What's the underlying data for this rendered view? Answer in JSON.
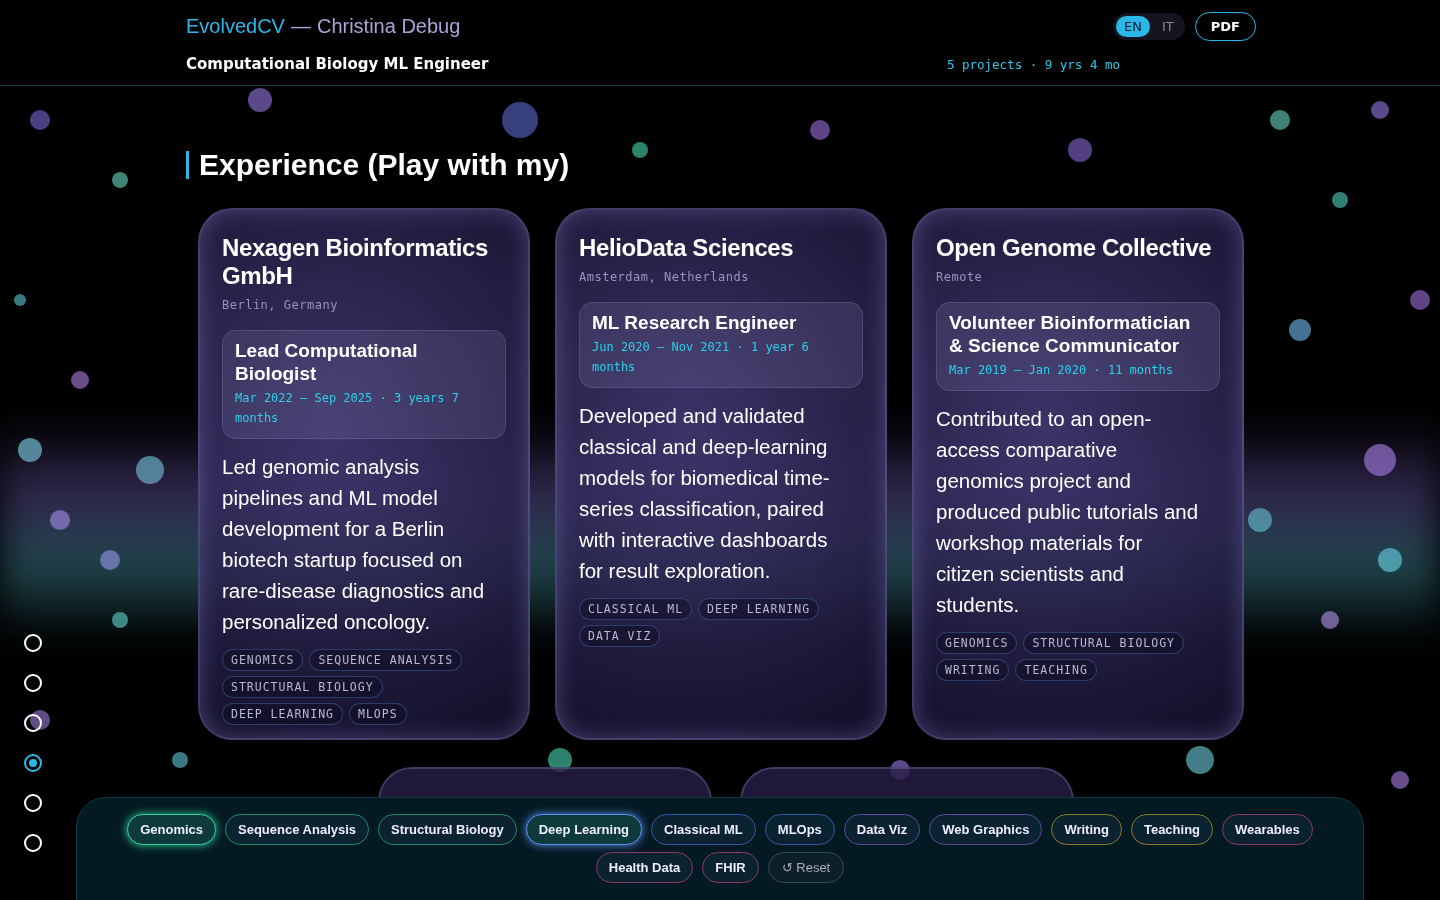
{
  "header": {
    "brand": "EvolvedCV",
    "separator": "—",
    "name": "Christina Debug",
    "role": "Computational Biology ML Engineer",
    "stats": "5 projects · 9 yrs 4 mo",
    "languages": [
      {
        "label": "EN",
        "selected": true
      },
      {
        "label": "IT",
        "selected": false
      }
    ],
    "pdf_button": "PDF"
  },
  "section": {
    "title": "Experience (Play with my)"
  },
  "experience": [
    {
      "company": "Nexagen Bioinformatics GmbH",
      "location": "Berlin, Germany",
      "role": "Lead Computational Biologist",
      "period": "Mar 2022 – Sep 2025 · 3 years 7 months",
      "description": "Led genomic analysis pipelines and ML model development for a Berlin biotech startup focused on rare-disease diagnostics and personalized oncology.",
      "tags": [
        "GENOMICS",
        "SEQUENCE ANALYSIS",
        "STRUCTURAL BIOLOGY",
        "DEEP LEARNING",
        "MLOPS"
      ]
    },
    {
      "company": "HelioData Sciences",
      "location": "Amsterdam, Netherlands",
      "role": "ML Research Engineer",
      "period": "Jun 2020 – Nov 2021 · 1 year 6 months",
      "description": "Developed and validated classical and deep-learning models for biomedical time-series classification, paired with interactive dashboards for result exploration.",
      "tags": [
        "CLASSICAL ML",
        "DEEP LEARNING",
        "DATA VIZ"
      ]
    },
    {
      "company": "Open Genome Collective",
      "location": "Remote",
      "role": "Volunteer Bioinformatician & Science Communicator",
      "period": "Mar 2019 – Jan 2020 · 11 months",
      "description": "Contributed to an open-access comparative genomics project and produced public tutorials and workshop materials for citizen scientists and students.",
      "tags": [
        "GENOMICS",
        "STRUCTURAL BIOLOGY",
        "WRITING",
        "TEACHING"
      ]
    }
  ],
  "section_nav": [
    {
      "selected": false
    },
    {
      "selected": false
    },
    {
      "selected": false
    },
    {
      "selected": true
    },
    {
      "selected": false
    },
    {
      "selected": false
    }
  ],
  "filters": [
    {
      "label": "Genomics",
      "color": "#2fcf9a",
      "selected": true
    },
    {
      "label": "Sequence Analysis",
      "color": "#1f8a68",
      "selected": false
    },
    {
      "label": "Structural Biology",
      "color": "#1f8a68",
      "selected": false
    },
    {
      "label": "Deep Learning",
      "color": "#5b8cf0",
      "selected": true
    },
    {
      "label": "Classical ML",
      "color": "#2f5a9e",
      "selected": false
    },
    {
      "label": "MLOps",
      "color": "#2f5a9e",
      "selected": false
    },
    {
      "label": "Data Viz",
      "color": "#5a4a9a",
      "selected": false
    },
    {
      "label": "Web Graphics",
      "color": "#5a4a9a",
      "selected": false
    },
    {
      "label": "Writing",
      "color": "#8a7a2a",
      "selected": false
    },
    {
      "label": "Teaching",
      "color": "#8a7a2a",
      "selected": false
    },
    {
      "label": "Wearables",
      "color": "#8a3a6a",
      "selected": false
    },
    {
      "label": "Health Data",
      "color": "#8a3a6a",
      "selected": false
    },
    {
      "label": "FHIR",
      "color": "#8a3a6a",
      "selected": false
    }
  ],
  "reset_button": {
    "icon": "↺",
    "label": "Reset"
  }
}
